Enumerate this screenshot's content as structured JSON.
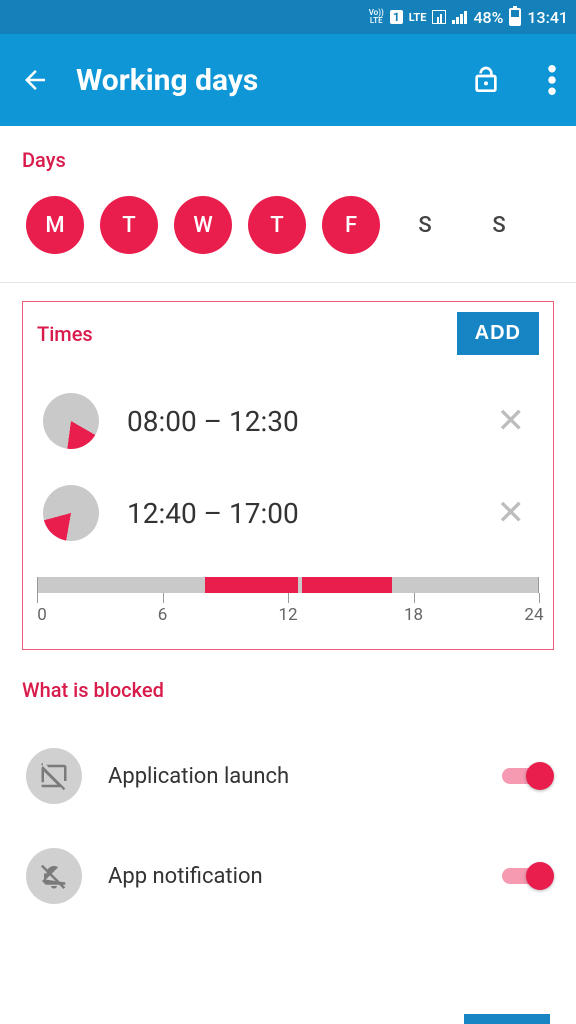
{
  "status_bar": {
    "volte": "Vo))\nLTE",
    "sim": "1",
    "lte": "LTE",
    "battery_pct": "48%",
    "time": "13:41"
  },
  "app_bar": {
    "title": "Working days"
  },
  "days": {
    "section_title": "Days",
    "items": [
      {
        "label": "M",
        "selected": true
      },
      {
        "label": "T",
        "selected": true
      },
      {
        "label": "W",
        "selected": true
      },
      {
        "label": "T",
        "selected": true
      },
      {
        "label": "F",
        "selected": true
      },
      {
        "label": "S",
        "selected": false
      },
      {
        "label": "S",
        "selected": false
      }
    ]
  },
  "times": {
    "section_title": "Times",
    "add_label": "ADD",
    "ranges": [
      {
        "label": "08:00 – 12:30",
        "start_h": 8.0,
        "end_h": 12.5
      },
      {
        "label": "12:40 – 17:00",
        "start_h": 12.67,
        "end_h": 17.0
      }
    ],
    "timeline": {
      "ticks": [
        0,
        6,
        12,
        18,
        24
      ],
      "labels": [
        "0",
        "6",
        "12",
        "18",
        "24"
      ]
    }
  },
  "blocked": {
    "section_title": "What is blocked",
    "items": [
      {
        "label": "Application launch",
        "icon": "laptop-off",
        "on": true
      },
      {
        "label": "App notification",
        "icon": "bell-off",
        "on": true
      }
    ]
  },
  "colors": {
    "accent": "#e91e4d",
    "primary": "#0e96d6",
    "heading": "#d81b4b"
  }
}
